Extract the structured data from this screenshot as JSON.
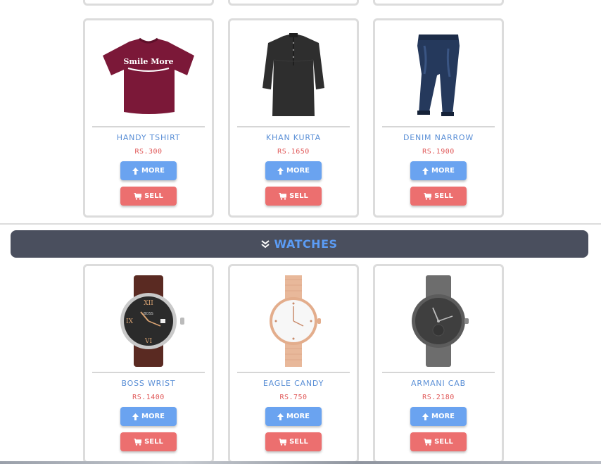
{
  "colors": {
    "product_name": "#5a8fd6",
    "price": "#e05858",
    "more_button": "#6aa3f0",
    "sell_button": "#ec6f6f",
    "section_bar": "#4a4f5e",
    "section_title": "#5b9cf5"
  },
  "buttons": {
    "more_label": "MORE",
    "more_icon": "arrow-up-icon",
    "sell_label": "SELL",
    "sell_icon": "cart-icon"
  },
  "clothing": {
    "products": [
      {
        "name": "HANDY TSHIRT",
        "price": "RS.300",
        "image": "tshirt-image",
        "print": "Smile More"
      },
      {
        "name": "KHAN KURTA",
        "price": "RS.1650",
        "image": "kurta-image"
      },
      {
        "name": "DENIM NARROW",
        "price": "RS.1900",
        "image": "jeans-image"
      }
    ]
  },
  "watches_section": {
    "title": "WATCHES",
    "icon": "double-chevron-down-icon",
    "products": [
      {
        "name": "BOSS WRIST",
        "price": "RS.1400",
        "image": "boss-watch-image"
      },
      {
        "name": "EAGLE CANDY",
        "price": "RS.750",
        "image": "eagle-watch-image"
      },
      {
        "name": "ARMANI CAB",
        "price": "RS.2180",
        "image": "armani-watch-image"
      }
    ]
  }
}
